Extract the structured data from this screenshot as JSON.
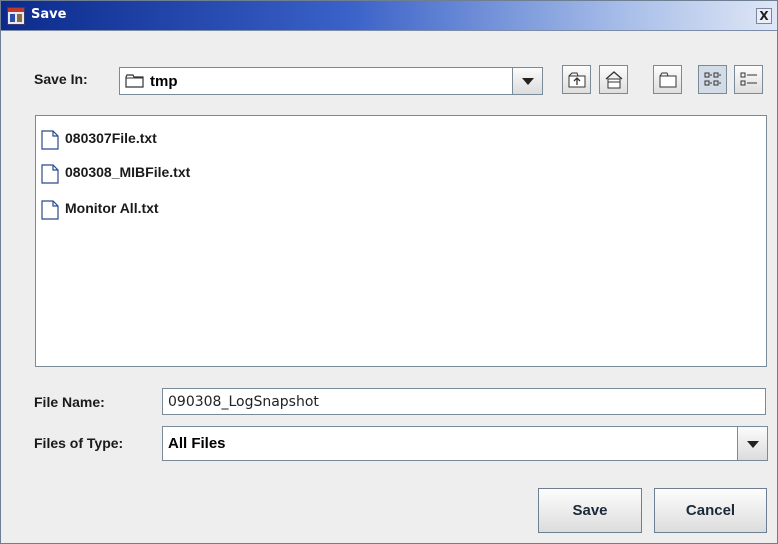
{
  "window": {
    "title": "Save",
    "close_glyph": "X",
    "app_icon": "app-icon"
  },
  "save_in": {
    "label": "Save In:",
    "value": "tmp",
    "folder_icon": "folder-icon"
  },
  "toolbar": [
    {
      "name": "up-one-level",
      "icon": "up-folder-icon"
    },
    {
      "name": "home",
      "icon": "home-icon"
    },
    {
      "name": "new-folder",
      "icon": "new-folder-icon"
    },
    {
      "name": "list-view",
      "icon": "list-view-icon",
      "selected": true
    },
    {
      "name": "details-view",
      "icon": "details-view-icon",
      "selected": false
    }
  ],
  "files": [
    {
      "name": "080307File.txt",
      "icon": "file-icon"
    },
    {
      "name": "080308_MIBFile.txt",
      "icon": "file-icon"
    },
    {
      "name": "Monitor All.txt",
      "icon": "file-icon"
    }
  ],
  "file_name": {
    "label": "File Name:",
    "value": "090308_LogSnapshot"
  },
  "files_of_type": {
    "label": "Files of Type:",
    "value": "All Files"
  },
  "buttons": {
    "save": "Save",
    "cancel": "Cancel"
  }
}
